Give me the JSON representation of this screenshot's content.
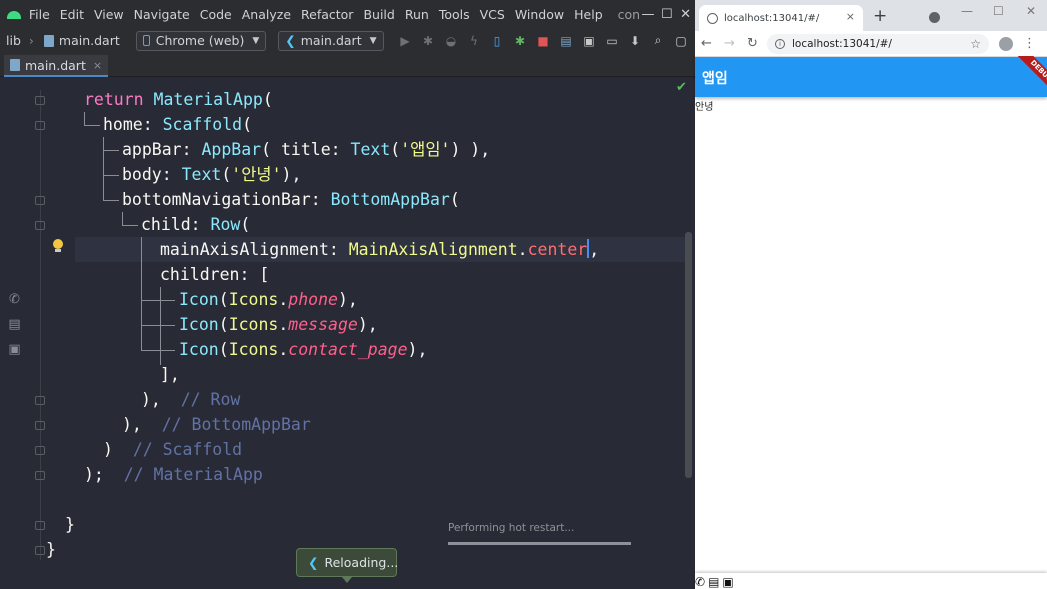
{
  "ide": {
    "menu": [
      "File",
      "Edit",
      "View",
      "Navigate",
      "Code",
      "Analyze",
      "Refactor",
      "Build",
      "Run",
      "Tools",
      "VCS",
      "Window",
      "Help"
    ],
    "project_title": "contact",
    "window_controls": {
      "minimize": "—",
      "maximize": "☐",
      "close": "✕"
    },
    "breadcrumb": {
      "folder": "lib",
      "file": "main.dart"
    },
    "device_selector": "Chrome (web)",
    "run_config": "main.dart",
    "tab": {
      "label": "main.dart",
      "close": "×"
    },
    "code_lines": [
      [
        [
          "kw",
          "return "
        ],
        [
          "cls",
          "MaterialApp"
        ],
        [
          "punc",
          "("
        ]
      ],
      [
        [
          "id",
          "home: "
        ],
        [
          "cls",
          "Scaffold"
        ],
        [
          "punc",
          "("
        ]
      ],
      [
        [
          "id",
          "appBar: "
        ],
        [
          "cls",
          "AppBar"
        ],
        [
          "punc",
          "( "
        ],
        [
          "id",
          "title: "
        ],
        [
          "cls",
          "Text"
        ],
        [
          "punc",
          "("
        ],
        [
          "str",
          "'앱임'"
        ],
        [
          "punc",
          ") ),"
        ]
      ],
      [
        [
          "id",
          "body: "
        ],
        [
          "cls",
          "Text"
        ],
        [
          "punc",
          "("
        ],
        [
          "str",
          "'안녕'"
        ],
        [
          "punc",
          "),"
        ]
      ],
      [
        [
          "id",
          "bottomNavigationBar: "
        ],
        [
          "cls",
          "BottomAppBar"
        ],
        [
          "punc",
          "("
        ]
      ],
      [
        [
          "id",
          "child: "
        ],
        [
          "cls",
          "Row"
        ],
        [
          "punc",
          "("
        ]
      ],
      [
        [
          "id",
          "mainAxisAlignment: "
        ],
        [
          "enumc",
          "MainAxisAlignment"
        ],
        [
          "punc",
          "."
        ],
        [
          "member",
          "center"
        ],
        [
          "caret",
          ""
        ],
        [
          "punc",
          ","
        ]
      ],
      [
        [
          "id",
          "children: ["
        ]
      ],
      [
        [
          "cls",
          "Icon"
        ],
        [
          "punc",
          "("
        ],
        [
          "enumc",
          "Icons"
        ],
        [
          "punc",
          "."
        ],
        [
          "const",
          "phone"
        ],
        [
          "punc",
          "),"
        ]
      ],
      [
        [
          "cls",
          "Icon"
        ],
        [
          "punc",
          "("
        ],
        [
          "enumc",
          "Icons"
        ],
        [
          "punc",
          "."
        ],
        [
          "const",
          "message"
        ],
        [
          "punc",
          "),"
        ]
      ],
      [
        [
          "cls",
          "Icon"
        ],
        [
          "punc",
          "("
        ],
        [
          "enumc",
          "Icons"
        ],
        [
          "punc",
          "."
        ],
        [
          "const",
          "contact_page"
        ],
        [
          "punc",
          "),"
        ]
      ],
      [
        [
          "punc",
          "],"
        ]
      ],
      [
        [
          "punc",
          "),  "
        ],
        [
          "cmt",
          "// Row"
        ]
      ],
      [
        [
          "punc",
          "),  "
        ],
        [
          "cmt",
          "// BottomAppBar"
        ]
      ],
      [
        [
          "punc",
          ")  "
        ],
        [
          "cmt",
          "// Scaffold"
        ]
      ],
      [
        [
          "punc",
          ");  "
        ],
        [
          "cmt",
          "// MaterialApp"
        ]
      ],
      [],
      [
        [
          "punc",
          "}"
        ]
      ],
      [
        [
          "punc",
          "}"
        ]
      ]
    ],
    "progress": {
      "label": "Performing hot restart...",
      "fraction": 1.0
    },
    "toast": "Reloading..."
  },
  "browser": {
    "tab_title": "localhost:13041/#/",
    "tab_close": "×",
    "new_tab": "+",
    "url": "localhost:13041/#/",
    "window_controls": {
      "minimize": "—",
      "maximize": "☐",
      "close": "✕"
    },
    "app": {
      "appbar_title": "앱임",
      "body_text": "안녕",
      "debug_label": "DEBUG",
      "bottom_icons": [
        "phone-icon",
        "message-icon",
        "contact-page-icon"
      ]
    }
  },
  "colors": {
    "appbar": "#2196f3",
    "editor_bg": "#282a36",
    "keyword": "#ff79c6",
    "class": "#8be9fd",
    "string": "#f1fa8c",
    "comment": "#6272a4"
  }
}
